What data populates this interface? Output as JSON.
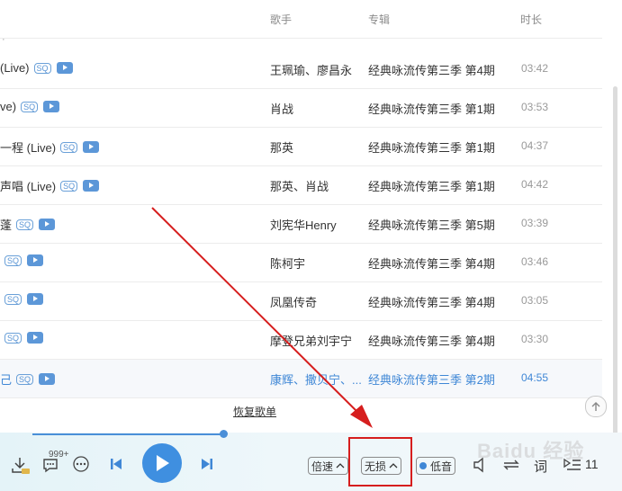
{
  "header": {
    "col_singer": "歌手",
    "col_album": "专辑",
    "col_duration": "时长"
  },
  "top_dash": "·",
  "rows": [
    {
      "title": "(Live)",
      "singer": "王珮瑜、廖昌永",
      "album": "经典咏流传第三季 第4期",
      "duration": "03:42"
    },
    {
      "title": "ve)",
      "singer": "肖战",
      "album": "经典咏流传第三季 第1期",
      "duration": "03:53"
    },
    {
      "title": "一程 (Live)",
      "singer": "那英",
      "album": "经典咏流传第三季 第1期",
      "duration": "04:37"
    },
    {
      "title": "声唱 (Live)",
      "singer": "那英、肖战",
      "album": "经典咏流传第三季 第1期",
      "duration": "04:42"
    },
    {
      "title": "蓬",
      "singer": "刘宪华Henry",
      "album": "经典咏流传第三季 第5期",
      "duration": "03:39"
    },
    {
      "title": "",
      "singer": "陈柯宇",
      "album": "经典咏流传第三季 第4期",
      "duration": "03:46"
    },
    {
      "title": "",
      "singer": "凤凰传奇",
      "album": "经典咏流传第三季 第4期",
      "duration": "03:05"
    },
    {
      "title": "",
      "singer": "摩登兄弟刘宇宁",
      "album": "经典咏流传第三季 第4期",
      "duration": "03:30"
    },
    {
      "title": "己",
      "singer": "康辉、撒贝宁、...",
      "album": "经典咏流传第三季 第2期",
      "duration": "04:55",
      "active": true
    }
  ],
  "quality_badge": "SQ",
  "restore_link": "恢复歌单",
  "player": {
    "comment_count": "999+",
    "speed_label": "倍速",
    "quality_label": "无损",
    "bass_label": "低音",
    "lyric_label": "词",
    "playlist_count": "11",
    "watermark": "Baidu 经验"
  },
  "colors": {
    "accent": "#3f87d6",
    "highlight_box": "#d61e1e",
    "arrow": "#d61e1e"
  }
}
